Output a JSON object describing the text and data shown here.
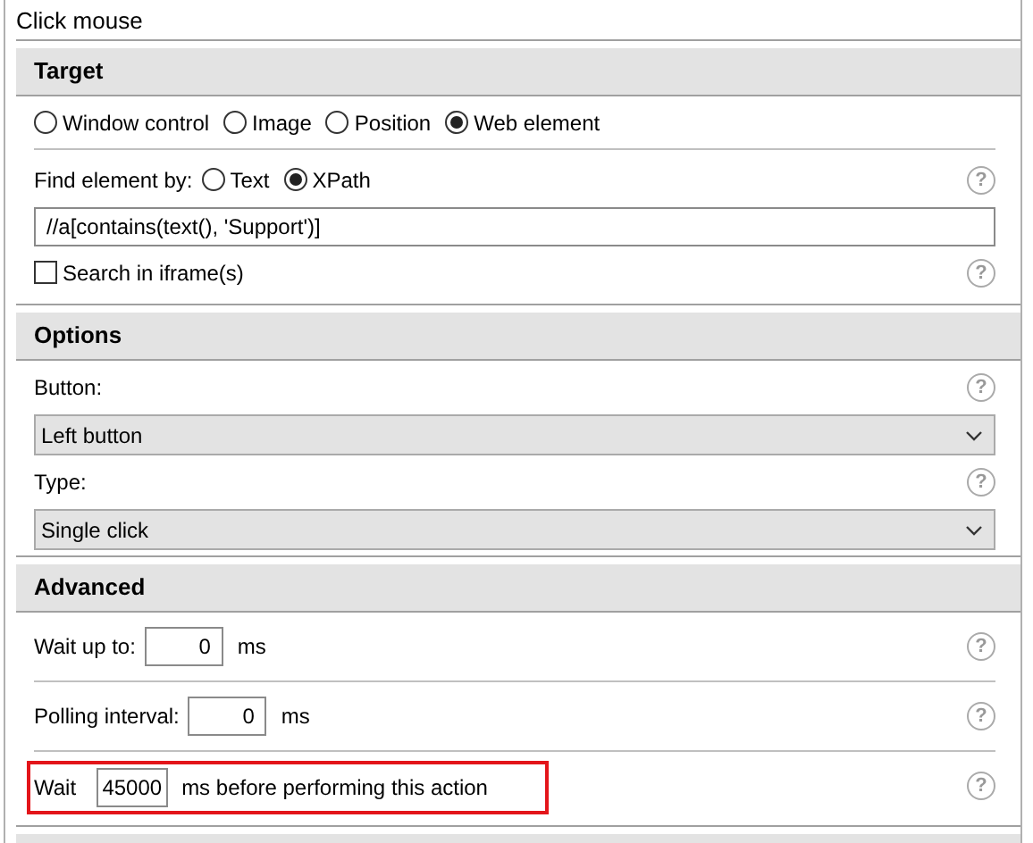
{
  "title": "Click mouse",
  "sections": [
    {
      "title": "Target",
      "rows": [
        {
          "kind": "radios",
          "options": [
            {
              "label": "Window control",
              "selected": false
            },
            {
              "label": "Image",
              "selected": false
            },
            {
              "label": "Position",
              "selected": false
            },
            {
              "label": "Web element",
              "selected": true
            }
          ]
        },
        {
          "kind": "divider"
        },
        {
          "kind": "radios",
          "label": "Find element by:",
          "help": "?",
          "options": [
            {
              "label": "Text",
              "selected": false
            },
            {
              "label": "XPath",
              "selected": true
            }
          ]
        },
        {
          "kind": "text",
          "value": "//a[contains(text(), 'Support')]"
        },
        {
          "kind": "checkbox",
          "label": "Search in iframe(s)",
          "checked": false,
          "help": "?"
        }
      ]
    },
    {
      "title": "Options",
      "rows": [
        {
          "kind": "label",
          "label": "Button:",
          "help": "?"
        },
        {
          "kind": "select",
          "value": "Left button"
        },
        {
          "kind": "label",
          "label": "Type:",
          "help": "?"
        },
        {
          "kind": "select",
          "value": "Single click"
        }
      ]
    },
    {
      "title": "Advanced",
      "rows": [
        {
          "kind": "number",
          "label": "Wait up to:",
          "value": "0",
          "unit": "ms",
          "help": "?",
          "highlighted": false
        },
        {
          "kind": "divider"
        },
        {
          "kind": "number",
          "label": "Polling interval:",
          "value": "0",
          "unit": "ms",
          "help": "?",
          "highlighted": false
        },
        {
          "kind": "divider"
        },
        {
          "kind": "number",
          "label": "Wait",
          "value": "45000",
          "unit": "ms before performing this action",
          "help": "?",
          "highlighted": true
        }
      ]
    }
  ]
}
